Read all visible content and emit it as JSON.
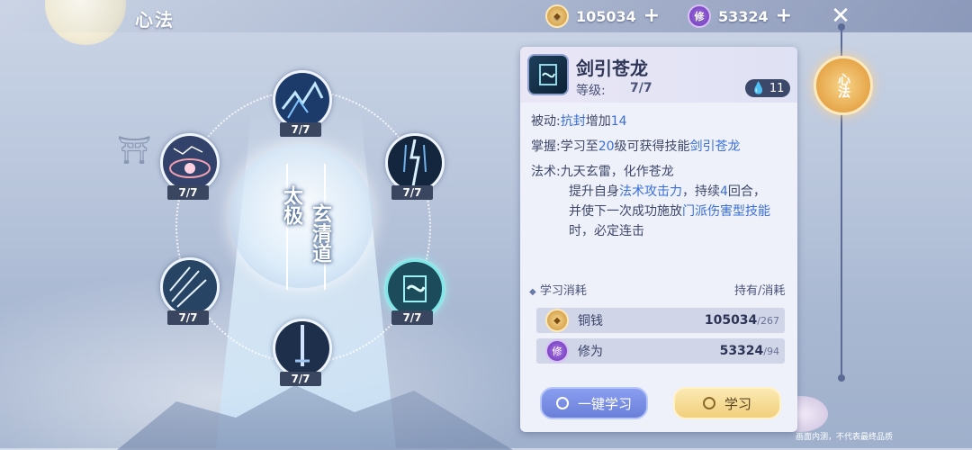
{
  "header": {
    "title": "心法",
    "copper": "105034",
    "cultivation": "53324",
    "xiu_glyph": "修"
  },
  "center": {
    "left_text": "太极",
    "right_text": "玄清道"
  },
  "skills": [
    {
      "level": "7/7",
      "icon": "lightning-dragon-icon"
    },
    {
      "level": "7/7",
      "icon": "thunder-pillar-icon"
    },
    {
      "level": "7/7",
      "icon": "taiji-seal-icon"
    },
    {
      "level": "7/7",
      "icon": "sword-pillar-icon"
    },
    {
      "level": "7/7",
      "icon": "ice-shards-icon"
    },
    {
      "level": "7/7",
      "icon": "star-circle-icon"
    }
  ],
  "detail": {
    "name": "剑引苍龙",
    "level_label": "等级:",
    "level_value": "7/7",
    "drop_count": "11",
    "passive_label": "被动:",
    "passive_a": "抗封",
    "passive_b": "增加",
    "passive_c": "14",
    "master_label": "掌握:",
    "master_a": "学习至",
    "master_b": "20",
    "master_c": "级可获得技能",
    "master_d": "剑引苍龙",
    "skill_label": "法术:",
    "skill_line1": "九天玄雷，化作苍龙",
    "skill_l2a": "提升自身",
    "skill_l2b": "法术攻击力",
    "skill_l2c": "，持续",
    "skill_l2d": "4",
    "skill_l2e": "回合，",
    "skill_l3a": "并使下一次成功施放",
    "skill_l3b": "门派伤害型技能",
    "skill_l4": "时，必定连击"
  },
  "cost": {
    "title": "学习消耗",
    "right": "持有/消耗",
    "rows": [
      {
        "name": "铜钱",
        "have": "105034",
        "need": "/267"
      },
      {
        "name": "修为",
        "have": "53324",
        "need": "/94"
      }
    ]
  },
  "buttons": {
    "learn_all": "一键学习",
    "learn": "学习"
  },
  "emblem": {
    "label": "心法"
  },
  "watermark": "画面内测，不代表最终品质",
  "colors": {
    "highlight": "#3a6ed8",
    "panel": "#eef1f9",
    "accent_gold": "#e6a64a"
  }
}
